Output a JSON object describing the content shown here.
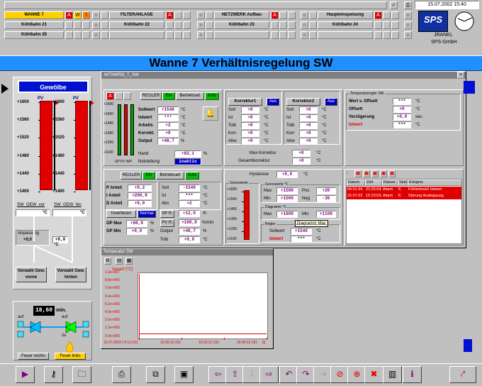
{
  "header": {
    "date_time": "15.07.2002 15:40",
    "company_line1": "JRANKL",
    "company_line2": "SPS-GmbH",
    "logo_text": "SPS"
  },
  "status_grid": {
    "row1": [
      {
        "label": "WANNE 7",
        "alarm": "A"
      },
      {
        "label": "FILTERANLAGE",
        "alarm": "A"
      },
      {
        "label": "NETZWERK Aufbau",
        "alarm": "A"
      },
      {
        "label": "Haupteinspeisung",
        "alarm": "A"
      }
    ],
    "row2": [
      "Kühlbahn 21",
      "Kühlbahn 22",
      "Kühlbahn 23",
      "Kühlbahn 24"
    ],
    "row3": [
      "Kühlbahn 25"
    ]
  },
  "page_title": "Wanne 7 Verhältnisregelung SW",
  "left": {
    "title": "Gewölbe",
    "pv": "PV",
    "ticks": [
      "+1600",
      "+1560",
      "+1520",
      "+1480",
      "+1440",
      "+1400"
    ],
    "tag1": "SW_GEW_vor",
    "tag2": "SW_GEW_hin",
    "deg": "°C",
    "anpassung": "Anpassung",
    "anp_val1": "+0,0",
    "anp_val2": "+0,0",
    "btn_vorne": "Vorwahl Gew. vorne",
    "btn_hinten": "Vorwahl Gew. hinten",
    "timer_val": "18,60",
    "timer_unit": "min.",
    "auf": "auf",
    "zu": "zu",
    "btn_feuer_rechts": "Feuer rechts",
    "btn_feuer_links": "Feuer links"
  },
  "dialog": {
    "title": "W7SWPID_T_SW",
    "bar_ticks": [
      "+1600",
      "+1500",
      "+1400",
      "+1300",
      "+1200",
      "+1100"
    ],
    "bar_labels": "SP PV WP",
    "regler": {
      "label": "REGLER",
      "ein": "Ein",
      "betriebsart": "Betriebsart",
      "auto": "Auto",
      "rows": [
        {
          "l": "Sollwert",
          "v": "+1540",
          "u": "°C"
        },
        {
          "l": "Istwert",
          "v": "***",
          "u": "°C"
        },
        {
          "l": "Arbeits",
          "v": "+2",
          "u": "°C"
        },
        {
          "l": "Korrekt.",
          "v": "+0",
          "u": "°C"
        },
        {
          "l": "Output",
          "v": "+48,7",
          "u": "%"
        }
      ]
    },
    "hand": {
      "l": "Hand",
      "v": "+83,1",
      "u": "%"
    },
    "notstellung": {
      "l": "Notstellung",
      "v": "inaktiv"
    },
    "korrektur1": {
      "title": "Korrektur1",
      "aus": "Aus",
      "rows": [
        {
          "l": "Soll",
          "v": "+0"
        },
        {
          "l": "Ist",
          "v": "+0"
        },
        {
          "l": "Totb",
          "v": "+0"
        },
        {
          "l": "Korr",
          "v": "+0"
        },
        {
          "l": "Abw",
          "v": "+0"
        }
      ]
    },
    "korrektur2": {
      "title": "Korrektur2",
      "aus": "Aus",
      "rows": [
        {
          "l": "Soll",
          "v": "+0"
        },
        {
          "l": "Ist",
          "v": "+0"
        },
        {
          "l": "Totb",
          "v": "+0"
        },
        {
          "l": "Korr",
          "v": "+0"
        },
        {
          "l": "Abw",
          "v": "+0"
        }
      ]
    },
    "max_korrektur": {
      "l": "Max Korrektur",
      "v": "+0",
      "u": "°C"
    },
    "gesamt": {
      "l": "Gesamtkorrektur",
      "v": "+0",
      "u": "°C"
    },
    "temperaturregler": {
      "title": "Temperaturregler SW",
      "rows": [
        {
          "l": "Wert v. Offsett",
          "v": "***",
          "u": "°C"
        },
        {
          "l": "Offsett",
          "v": "+0",
          "u": "°C"
        },
        {
          "l": "Verzögerung",
          "v": "+0,0",
          "u": "sec."
        },
        {
          "l": "Istwert",
          "v": "***",
          "u": "°C"
        }
      ]
    },
    "regler2": {
      "label": "REGLER",
      "ein": "Ein",
      "betriebsart": "Betriebsart",
      "auto": "Auto"
    },
    "pid": [
      {
        "l": "P Anteil",
        "v": "+0,2"
      },
      {
        "l": "I Anteil",
        "v": "+200,0"
      },
      {
        "l": "D Anteil",
        "v": "+0,0"
      }
    ],
    "right_pid": [
      {
        "l": "Soll",
        "v": "-1540",
        "u": "°C"
      },
      {
        "l": "Ist",
        "v": "***",
        "u": "°C"
      },
      {
        "l": "Abs",
        "v": "+2",
        "u": "°C"
      }
    ],
    "invertieren": "Invertieren",
    "normal": "Normal",
    "sp_r": {
      "l": "SP R.",
      "v": "+12,0",
      "u": "/h"
    },
    "op_max": {
      "l": "OP Max",
      "v": "+60,0",
      "u": "%"
    },
    "op_min": {
      "l": "OP Min",
      "v": "+0,0",
      "u": "%"
    },
    "pv_r": {
      "l": "PV R.",
      "v": "+100,0",
      "u": "%/min"
    },
    "output": {
      "l": "Output",
      "v": "+48,7",
      "u": "%"
    },
    "totb": {
      "l": "Totb",
      "v": "+0,0",
      "u": "°C"
    },
    "hysterese": {
      "l": "Hysterese",
      "v": "+0,0",
      "u": "°C"
    },
    "grenzwerte_title": "Grenzwerte",
    "grenz_ticks": [
      "+1600",
      "+1500",
      "+1400",
      "+1300",
      "+1200",
      "+1100"
    ],
    "grenzwerte_c": {
      "title": "Grenzwerte °C",
      "max": "+1590",
      "min": "+1500",
      "pos": "+20",
      "neg": "-30"
    },
    "diagramm": {
      "title": "Diagramm °C",
      "max": "+1600",
      "min": "+1100",
      "tooltip": "Diagramm Max"
    },
    "regler3": {
      "title": "Regler",
      "sollwert_l": "Sollwert",
      "sollwert": "+1540",
      "istwert_l": "Istwert",
      "istwert": "***",
      "u": "°C"
    }
  },
  "alarms": {
    "headers": [
      "Datum",
      "Zeit",
      "Klasse",
      "Status",
      "Ereignis"
    ],
    "rows": [
      [
        "04.01.94",
        "22:25:04.27",
        "Alarm",
        "K",
        "Fühlerbruch Istwert"
      ],
      [
        "15.07.02",
        "15:23:53.27",
        "Alarm",
        "K",
        "Störung Analogausg."
      ]
    ]
  },
  "trend": {
    "title": "Temperatur SW",
    "unit": "Istwert [°C]",
    "yticks": [
      "1.0e+007",
      "8.8e+006",
      "7.6e+006",
      "6.4e+006",
      "5.2e+006",
      "4.0e+006",
      "2.6e+006",
      "1.3e+006",
      "0.0e+000"
    ],
    "xticks": [
      "15.07.2002 14:12:151",
      "15:00:12:151",
      "15:20:12:151",
      "15:40:12:151"
    ],
    "xunit": "[t]"
  }
}
